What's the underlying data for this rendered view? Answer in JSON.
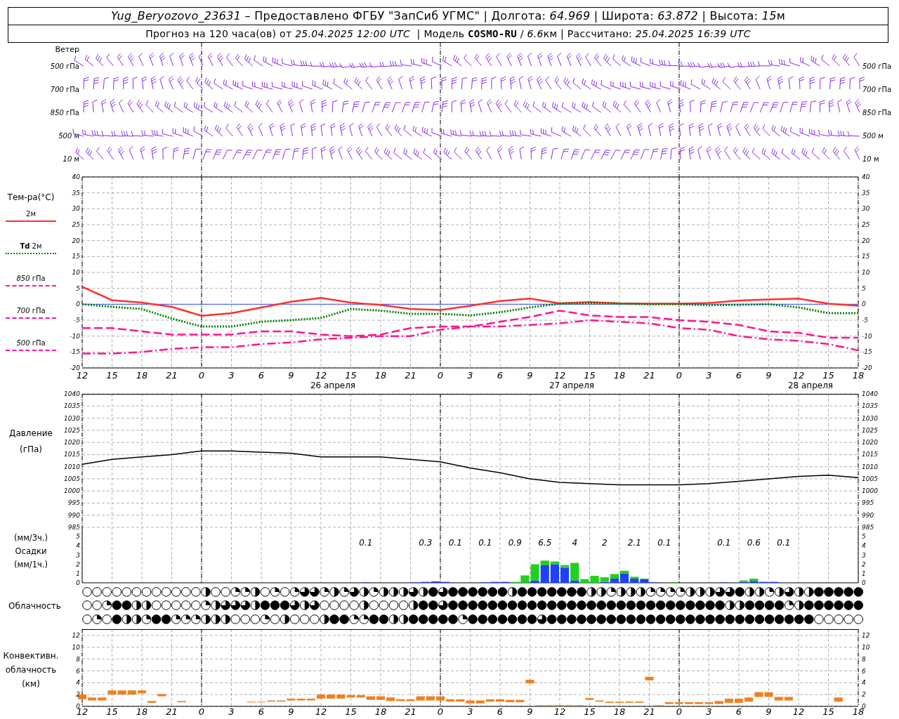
{
  "header": {
    "lines": [
      [
        {
          "text": "Yug_Beryozovo_23631",
          "kind": "italic"
        },
        {
          "text": " – Предоставлено ФГБУ \"ЗапСиб УГМС\" | Долгота: ",
          "kind": "plain"
        },
        {
          "text": "64.969",
          "kind": "italic"
        },
        {
          "text": " | Широта: ",
          "kind": "plain"
        },
        {
          "text": "63.872",
          "kind": "italic"
        },
        {
          "text": " | Высота: ",
          "kind": "plain"
        },
        {
          "text": "15",
          "kind": "italic"
        },
        {
          "text": "м",
          "kind": "plain"
        }
      ],
      [
        {
          "text": "Прогноз на 120 часа(ов) от ",
          "kind": "plain"
        },
        {
          "text": "25.04.2025 12:00 UTC",
          "kind": "italic"
        },
        {
          "text": "  | Модель ",
          "kind": "plain"
        },
        {
          "text": "COSMO-RU",
          "kind": "bold"
        },
        {
          "text": " / ",
          "kind": "plain"
        },
        {
          "text": "6.6",
          "kind": "italic"
        },
        {
          "text": "км | Рассчитано: ",
          "kind": "plain"
        },
        {
          "text": "25.04.2025 16:39 UTC",
          "kind": "italic"
        }
      ]
    ]
  },
  "wind": {
    "label": "Ветер",
    "levels": [
      "*500* гПа",
      "*700* гПа",
      "*850* гПа",
      "*500* м",
      "*10* м"
    ],
    "right_levels": [
      "*500* гПа",
      "*700* гПа",
      "*850* гПа",
      "*500* м",
      "*10* м"
    ]
  },
  "temperature": {
    "label": "Тем-ра(°C)",
    "legend": [
      {
        "label": "2м",
        "color": "#ff3030",
        "kind": "solid"
      },
      {
        "label": "**Td** 2м",
        "color": "#008000",
        "kind": "dotted"
      },
      {
        "label": "*850* гПа",
        "color": "#ff1493",
        "kind": "longdash"
      },
      {
        "label": "*700* гПа",
        "color": "#ff1493",
        "kind": "dashdot"
      },
      {
        "label": "*500* гПа",
        "color": "#ff1493",
        "kind": "dashed"
      }
    ],
    "chart_data": {
      "type": "line",
      "categories": [
        "12",
        "15",
        "18",
        "21",
        "0",
        "3",
        "6",
        "9",
        "12",
        "15",
        "18",
        "21",
        "0",
        "3",
        "6",
        "9",
        "12",
        "15",
        "18",
        "21",
        "0",
        "3",
        "6",
        "9",
        "12",
        "15",
        "18"
      ],
      "series": [
        {
          "color": "#3050ff",
          "line_style": "solid",
          "values": [
            0,
            0,
            0,
            0,
            0,
            0,
            0,
            0,
            0,
            0,
            0,
            0,
            0,
            0,
            0,
            0,
            0,
            0,
            0,
            0,
            0,
            0,
            0,
            0,
            0,
            0,
            0
          ]
        },
        {
          "color": "#ff3030",
          "line_style": "solid",
          "values": [
            5.5,
            1.3,
            0.5,
            -0.8,
            -3.6,
            -2.8,
            -1.0,
            0.8,
            2.0,
            0.5,
            -0.2,
            -1.5,
            -1.8,
            -0.5,
            1.0,
            1.8,
            0.3,
            0.7,
            0.3,
            0.2,
            0.2,
            0.4,
            1.2,
            1.5,
            1.8,
            0.2,
            -0.5
          ]
        },
        {
          "color": "#008000",
          "line_style": "dotted",
          "values": [
            0.0,
            -0.8,
            -1.5,
            -4.5,
            -7.0,
            -7.0,
            -5.5,
            -5.0,
            -4.3,
            -1.5,
            -2.0,
            -3.0,
            -3.0,
            -3.5,
            -2.5,
            -1.0,
            0.2,
            0.3,
            0.2,
            0.0,
            0.0,
            -0.3,
            -0.2,
            0.0,
            -1.0,
            -2.8,
            -2.8
          ]
        },
        {
          "color": "#ff1493",
          "line_style": "dashed",
          "values": [
            -7.5,
            -7.5,
            -8.5,
            -9.5,
            -9.5,
            -9.5,
            -8.5,
            -8.5,
            -9.5,
            -10.0,
            -9.5,
            -7.5,
            -7.0,
            -7.0,
            -5.5,
            -4.0,
            -2.0,
            -3.5,
            -4.0,
            -4.0,
            -5.0,
            -5.5,
            -6.5,
            -8.5,
            -9.0,
            -10.5,
            -10.5
          ]
        },
        {
          "color": "#ff1493",
          "line_style": "dashdot",
          "values": [
            -15.5,
            -15.5,
            -15.0,
            -14.0,
            -13.5,
            -13.5,
            -12.5,
            -12.0,
            -11.0,
            -10.5,
            -10.0,
            -10.0,
            -8.0,
            -7.0,
            -7.0,
            -6.5,
            -6.0,
            -5.0,
            -5.5,
            -6.0,
            -7.5,
            -8.0,
            -10.0,
            -11.0,
            -11.5,
            -12.5,
            -14.5
          ]
        }
      ],
      "ylim": [
        -20,
        40
      ],
      "yticks": [
        -20,
        -15,
        -10,
        -5,
        0,
        5,
        10,
        15,
        20,
        25,
        30,
        35,
        40
      ],
      "grid": true
    },
    "right_ticks": [
      "40",
      "35",
      "30",
      "25",
      "20",
      "15",
      "10",
      "5",
      "0",
      "-5",
      "-10",
      "-15",
      "-20"
    ],
    "day_labels": [
      "26 апреля",
      "27 апреля",
      "28 апреля"
    ]
  },
  "pressure": {
    "labels": [
      "Давление",
      "(гПа)"
    ],
    "chart_data": {
      "type": "line",
      "grid": true,
      "series": [
        {
          "color": "#000000",
          "values": [
            1011,
            1013,
            1014,
            1015,
            1016.5,
            1016.5,
            1016,
            1015.5,
            1014,
            1014,
            1014,
            1013,
            1012,
            1009.5,
            1007.5,
            1005,
            1003.5,
            1003,
            1002.5,
            1002.5,
            1002.5,
            1003,
            1004,
            1005,
            1006,
            1006.5,
            1005.5
          ]
        }
      ],
      "ylim": [
        985,
        1040
      ],
      "yticks": [
        985,
        990,
        995,
        1000,
        1005,
        1010,
        1015,
        1020,
        1025,
        1030,
        1035,
        1040
      ]
    },
    "right_ticks": [
      "1040",
      "1035",
      "1030",
      "1025",
      "1020",
      "1015",
      "1010",
      "1005",
      "1000",
      "995",
      "990",
      "985"
    ]
  },
  "precipitation": {
    "labels": [
      "(мм/3ч.)",
      "Осадки",
      "(мм/1ч.)"
    ],
    "chart_data": {
      "type": "bar",
      "stacked": true,
      "grid": true,
      "annotations": [
        "0.1",
        "0.3",
        "0.1",
        "0.1",
        "0.9",
        "6.5",
        "4",
        "2",
        "2.1",
        "0.1",
        "0.1",
        "0.6",
        "0.1"
      ],
      "series": [
        {
          "color": "#2040ff",
          "values": [
            0,
            0,
            0,
            0,
            0,
            0,
            0,
            0,
            0,
            0,
            0,
            0,
            0,
            0,
            0,
            0,
            0,
            0,
            0,
            0,
            0,
            0,
            0,
            0,
            0,
            0,
            0,
            0,
            0.05,
            0,
            0,
            0,
            0,
            0.05,
            0.1,
            0.15,
            0.1,
            0,
            0,
            0,
            0.05,
            0.1,
            0.1,
            0,
            0,
            0.25,
            1.9,
            2.0,
            1.6,
            0.25,
            0,
            0,
            0.1,
            0.45,
            1.0,
            0.45,
            0.4,
            0.05,
            0,
            0,
            0,
            0,
            0,
            0,
            0.05,
            0,
            0.1,
            0.2,
            0.1,
            0.1,
            0,
            0,
            0,
            0,
            0,
            0,
            0,
            0
          ]
        },
        {
          "color": "#20d020",
          "values": [
            0,
            0,
            0,
            0,
            0,
            0,
            0,
            0,
            0,
            0,
            0,
            0,
            0,
            0,
            0,
            0,
            0,
            0,
            0,
            0,
            0,
            0,
            0,
            0,
            0,
            0,
            0,
            0,
            0,
            0,
            0,
            0,
            0,
            0,
            0,
            0,
            0,
            0,
            0,
            0,
            0,
            0,
            0,
            0.1,
            0.8,
            1.75,
            0.5,
            0.3,
            0.3,
            1.9,
            0.4,
            0.75,
            0.5,
            0.5,
            0.3,
            0.2,
            0.05,
            0,
            0,
            0.05,
            0,
            0,
            0,
            0,
            0,
            0,
            0.15,
            0.25,
            0,
            0,
            0,
            0,
            0,
            0,
            0,
            0,
            0,
            0
          ]
        }
      ],
      "ylim": [
        0,
        6
      ],
      "yticks": [
        0,
        1,
        2,
        3,
        4,
        5
      ]
    },
    "right_ticks": [
      "5",
      "4",
      "3",
      "2",
      "1",
      "0"
    ]
  },
  "cloudiness": {
    "label": "Облачность",
    "rows": [
      {
        "cells": [
          {
            "kind": "clear"
          },
          {
            "kind": "clear"
          },
          {
            "kind": "clear"
          },
          {
            "kind": "clear"
          },
          {
            "kind": "clear"
          },
          {
            "kind": "clear"
          },
          {
            "kind": "clear"
          },
          {
            "kind": "clear"
          },
          {
            "kind": "clear"
          },
          {
            "kind": "clear"
          },
          {
            "kind": "clear"
          },
          {
            "kind": "clear"
          },
          {
            "kind": "half"
          },
          {
            "kind": "clear"
          },
          {
            "kind": "clear"
          },
          {
            "kind": "quarter"
          },
          {
            "kind": "quarter"
          },
          {
            "kind": "half"
          },
          {
            "kind": "clear"
          },
          {
            "kind": "quarter"
          },
          {
            "kind": "clear"
          },
          {
            "kind": "quarter"
          },
          {
            "kind": "threequarter"
          },
          {
            "kind": "threequarter"
          },
          {
            "kind": "quarter"
          },
          {
            "kind": "half"
          },
          {
            "kind": "quarter"
          },
          {
            "kind": "threequarter"
          },
          {
            "kind": "half"
          },
          {
            "kind": "quarter"
          },
          {
            "kind": "half"
          },
          {
            "kind": "half"
          },
          {
            "kind": "half"
          },
          {
            "kind": "threequarter"
          },
          {
            "kind": "half"
          },
          {
            "kind": "overcast"
          },
          {
            "kind": "threequarter"
          },
          {
            "kind": "overcast"
          },
          {
            "kind": "overcast"
          },
          {
            "kind": "overcast"
          },
          {
            "kind": "overcast"
          },
          {
            "kind": "overcast"
          },
          {
            "kind": "overcast"
          },
          {
            "kind": "half"
          },
          {
            "kind": "overcast"
          },
          {
            "kind": "overcast"
          },
          {
            "kind": "overcast"
          },
          {
            "kind": "overcast"
          },
          {
            "kind": "overcast"
          },
          {
            "kind": "overcast"
          },
          {
            "kind": "overcast"
          },
          {
            "kind": "half"
          },
          {
            "kind": "half"
          },
          {
            "kind": "quarter"
          },
          {
            "kind": "half"
          },
          {
            "kind": "half"
          },
          {
            "kind": "half"
          },
          {
            "kind": "quarter"
          },
          {
            "kind": "quarter"
          },
          {
            "kind": "quarter"
          },
          {
            "kind": "quarter"
          },
          {
            "kind": "half"
          },
          {
            "kind": "half"
          },
          {
            "kind": "half"
          },
          {
            "kind": "threequarter"
          },
          {
            "kind": "threequarter"
          },
          {
            "kind": "overcast"
          },
          {
            "kind": "half"
          },
          {
            "kind": "half"
          },
          {
            "kind": "quarter"
          },
          {
            "kind": "half"
          },
          {
            "kind": "threequarter"
          },
          {
            "kind": "half"
          },
          {
            "kind": "half"
          },
          {
            "kind": "overcast"
          },
          {
            "kind": "overcast"
          },
          {
            "kind": "overcast"
          },
          {
            "kind": "overcast"
          },
          {
            "kind": "overcast"
          }
        ]
      },
      {
        "cells": [
          {
            "kind": "clear"
          },
          {
            "kind": "clear"
          },
          {
            "kind": "quarter"
          },
          {
            "kind": "overcast"
          },
          {
            "kind": "overcast"
          },
          {
            "kind": "half"
          },
          {
            "kind": "half"
          },
          {
            "kind": "clear"
          },
          {
            "kind": "clear"
          },
          {
            "kind": "clear"
          },
          {
            "kind": "clear"
          },
          {
            "kind": "clear"
          },
          {
            "kind": "quarter"
          },
          {
            "kind": "half"
          },
          {
            "kind": "threequarter"
          },
          {
            "kind": "threequarter"
          },
          {
            "kind": "threequarter"
          },
          {
            "kind": "half"
          },
          {
            "kind": "overcast"
          },
          {
            "kind": "overcast"
          },
          {
            "kind": "overcast"
          },
          {
            "kind": "threequarter"
          },
          {
            "kind": "half"
          },
          {
            "kind": "threequarter"
          },
          {
            "kind": "clear"
          },
          {
            "kind": "clear"
          },
          {
            "kind": "clear"
          },
          {
            "kind": "clear"
          },
          {
            "kind": "half"
          },
          {
            "kind": "clear"
          },
          {
            "kind": "clear"
          },
          {
            "kind": "clear"
          },
          {
            "kind": "clear"
          },
          {
            "kind": "half"
          },
          {
            "kind": "overcast"
          },
          {
            "kind": "overcast"
          },
          {
            "kind": "threequarter"
          },
          {
            "kind": "overcast"
          },
          {
            "kind": "overcast"
          },
          {
            "kind": "overcast"
          },
          {
            "kind": "overcast"
          },
          {
            "kind": "overcast"
          },
          {
            "kind": "overcast"
          },
          {
            "kind": "overcast"
          },
          {
            "kind": "overcast"
          },
          {
            "kind": "overcast"
          },
          {
            "kind": "overcast"
          },
          {
            "kind": "overcast"
          },
          {
            "kind": "overcast"
          },
          {
            "kind": "overcast"
          },
          {
            "kind": "overcast"
          },
          {
            "kind": "overcast"
          },
          {
            "kind": "overcast"
          },
          {
            "kind": "overcast"
          },
          {
            "kind": "overcast"
          },
          {
            "kind": "overcast"
          },
          {
            "kind": "overcast"
          },
          {
            "kind": "overcast"
          },
          {
            "kind": "overcast"
          },
          {
            "kind": "overcast"
          },
          {
            "kind": "overcast"
          },
          {
            "kind": "overcast"
          },
          {
            "kind": "overcast"
          },
          {
            "kind": "overcast"
          },
          {
            "kind": "overcast"
          },
          {
            "kind": "half"
          },
          {
            "kind": "half"
          },
          {
            "kind": "overcast"
          },
          {
            "kind": "overcast"
          },
          {
            "kind": "overcast"
          },
          {
            "kind": "overcast"
          },
          {
            "kind": "quarter"
          },
          {
            "kind": "half"
          },
          {
            "kind": "overcast"
          },
          {
            "kind": "overcast"
          },
          {
            "kind": "overcast"
          },
          {
            "kind": "overcast"
          },
          {
            "kind": "overcast"
          },
          {
            "kind": "overcast"
          }
        ]
      },
      {
        "cells": [
          {
            "kind": "clear"
          },
          {
            "kind": "quarter"
          },
          {
            "kind": "clear"
          },
          {
            "kind": "overcast"
          },
          {
            "kind": "half"
          },
          {
            "kind": "half"
          },
          {
            "kind": "quarter"
          },
          {
            "kind": "overcast"
          },
          {
            "kind": "overcast"
          },
          {
            "kind": "quarter"
          },
          {
            "kind": "quarter"
          },
          {
            "kind": "quarter"
          },
          {
            "kind": "half"
          },
          {
            "kind": "half"
          },
          {
            "kind": "half"
          },
          {
            "kind": "clear"
          },
          {
            "kind": "clear"
          },
          {
            "kind": "clear"
          },
          {
            "kind": "quarter"
          },
          {
            "kind": "clear"
          },
          {
            "kind": "half"
          },
          {
            "kind": "clear"
          },
          {
            "kind": "clear"
          },
          {
            "kind": "clear"
          },
          {
            "kind": "half"
          },
          {
            "kind": "overcast"
          },
          {
            "kind": "overcast"
          },
          {
            "kind": "quarter"
          },
          {
            "kind": "quarter"
          },
          {
            "kind": "overcast"
          },
          {
            "kind": "overcast"
          },
          {
            "kind": "half"
          },
          {
            "kind": "half"
          },
          {
            "kind": "overcast"
          },
          {
            "kind": "overcast"
          },
          {
            "kind": "overcast"
          },
          {
            "kind": "overcast"
          },
          {
            "kind": "overcast"
          },
          {
            "kind": "quarter"
          },
          {
            "kind": "overcast"
          },
          {
            "kind": "overcast"
          },
          {
            "kind": "overcast"
          },
          {
            "kind": "overcast"
          },
          {
            "kind": "overcast"
          },
          {
            "kind": "overcast"
          },
          {
            "kind": "overcast"
          },
          {
            "kind": "threequarter"
          },
          {
            "kind": "overcast"
          },
          {
            "kind": "overcast"
          },
          {
            "kind": "overcast"
          },
          {
            "kind": "overcast"
          },
          {
            "kind": "overcast"
          },
          {
            "kind": "overcast"
          },
          {
            "kind": "overcast"
          },
          {
            "kind": "overcast"
          },
          {
            "kind": "overcast"
          },
          {
            "kind": "overcast"
          },
          {
            "kind": "overcast"
          },
          {
            "kind": "overcast"
          },
          {
            "kind": "overcast"
          },
          {
            "kind": "overcast"
          },
          {
            "kind": "overcast"
          },
          {
            "kind": "overcast"
          },
          {
            "kind": "overcast"
          },
          {
            "kind": "overcast"
          },
          {
            "kind": "overcast"
          },
          {
            "kind": "overcast"
          },
          {
            "kind": "overcast"
          },
          {
            "kind": "overcast"
          },
          {
            "kind": "overcast"
          },
          {
            "kind": "overcast"
          },
          {
            "kind": "overcast"
          },
          {
            "kind": "overcast"
          },
          {
            "kind": "overcast"
          },
          {
            "kind": "clear"
          },
          {
            "kind": "clear"
          },
          {
            "kind": "clear"
          },
          {
            "kind": "clear"
          },
          {
            "kind": "clear"
          }
        ]
      }
    ]
  },
  "convective": {
    "labels": [
      "Конвективн.",
      "облачность",
      "(км)"
    ],
    "chart_data": {
      "type": "candlestick",
      "categories": [
        "12",
        null,
        null,
        "15",
        null,
        null,
        "18",
        null,
        null,
        "21",
        null,
        null,
        "0",
        null,
        null,
        "3",
        null,
        null,
        "6",
        null,
        null,
        "9",
        null,
        null,
        "12",
        null,
        null,
        "15",
        null,
        null,
        "18",
        null,
        null,
        "21",
        null,
        null,
        "0",
        null,
        null,
        "3",
        null,
        null,
        "6",
        null,
        null,
        "9",
        null,
        null,
        "12",
        null,
        null,
        "15",
        null,
        null,
        "18",
        null,
        null,
        "21",
        null,
        null,
        "0",
        null,
        null,
        "3",
        null,
        null,
        "6",
        null,
        null,
        "9",
        null,
        null,
        "12",
        null,
        null,
        "15",
        null,
        null,
        "18"
      ],
      "series": [
        {
          "color": "#f08020",
          "ohlc": [
            [
              1.2,
              2.0,
              1.2,
              2.0
            ],
            [
              1.0,
              1.5,
              1.0,
              1.5
            ],
            [
              1.0,
              1.5,
              1.0,
              1.5
            ],
            [
              2.0,
              2.7,
              2.0,
              2.7
            ],
            [
              2.0,
              2.7,
              2.0,
              2.7
            ],
            [
              2.0,
              2.7,
              2.0,
              2.7
            ],
            [
              2.2,
              2.7,
              2.2,
              2.7
            ],
            [
              0.6,
              0.9,
              0.6,
              0.9
            ],
            [
              1.7,
              2.1,
              1.7,
              2.1
            ],
            null,
            [
              0.7,
              0.9,
              0.7,
              0.9
            ],
            null,
            null,
            null,
            null,
            null,
            null,
            [
              0.7,
              0.8,
              0.7,
              0.8
            ],
            [
              0.7,
              0.8,
              0.7,
              0.8
            ],
            [
              0.8,
              1.0,
              0.8,
              1.0
            ],
            [
              0.8,
              1.0,
              0.8,
              1.0
            ],
            [
              1.0,
              1.3,
              1.0,
              1.3
            ],
            [
              1.0,
              1.3,
              1.0,
              1.3
            ],
            [
              1.0,
              1.3,
              1.0,
              1.3
            ],
            [
              1.3,
              2.0,
              1.3,
              2.0
            ],
            [
              1.3,
              2.0,
              1.3,
              2.0
            ],
            [
              1.3,
              2.0,
              1.3,
              2.0
            ],
            [
              1.5,
              1.9,
              1.5,
              1.9
            ],
            [
              1.5,
              1.9,
              1.5,
              1.9
            ],
            [
              1.1,
              1.7,
              1.1,
              1.7
            ],
            [
              1.1,
              1.7,
              1.1,
              1.7
            ],
            [
              0.9,
              1.5,
              0.9,
              1.5
            ],
            [
              0.9,
              1.2,
              0.9,
              1.2
            ],
            [
              0.9,
              1.2,
              0.9,
              1.2
            ],
            [
              1.0,
              1.7,
              1.0,
              1.7
            ],
            [
              1.0,
              1.7,
              1.0,
              1.7
            ],
            [
              1.0,
              1.7,
              1.0,
              1.7
            ],
            [
              0.8,
              1.2,
              0.8,
              1.2
            ],
            [
              0.8,
              1.2,
              0.8,
              1.2
            ],
            [
              0.5,
              1.0,
              0.5,
              1.0
            ],
            [
              0.5,
              1.0,
              0.5,
              1.0
            ],
            [
              0.8,
              1.2,
              0.8,
              1.2
            ],
            [
              0.8,
              1.2,
              0.8,
              1.2
            ],
            [
              0.7,
              1.1,
              0.7,
              1.1
            ],
            [
              0.7,
              1.1,
              0.7,
              1.1
            ],
            [
              3.9,
              4.5,
              3.9,
              4.5
            ],
            [
              0.1,
              0.2,
              0.1,
              0.2
            ],
            [
              0.1,
              0.2,
              0.1,
              0.2
            ],
            [
              0.1,
              0.2,
              0.1,
              0.2
            ],
            [
              0.1,
              0.2,
              0.1,
              0.2
            ],
            [
              0.1,
              0.2,
              0.1,
              0.2
            ],
            [
              1.1,
              1.4,
              1.1,
              1.4
            ],
            [
              0.8,
              1.0,
              0.8,
              1.0
            ],
            [
              0.6,
              0.8,
              0.6,
              0.8
            ],
            [
              0.6,
              0.8,
              0.6,
              0.8
            ],
            [
              0.6,
              0.8,
              0.6,
              0.8
            ],
            [
              0.6,
              0.8,
              0.6,
              0.8
            ],
            [
              4.4,
              5.0,
              4.4,
              5.0
            ],
            [
              0.1,
              0.2,
              0.1,
              0.2
            ],
            [
              0.4,
              0.7,
              0.4,
              0.7
            ],
            [
              0.4,
              0.7,
              0.4,
              0.7
            ],
            [
              0.4,
              0.7,
              0.4,
              0.7
            ],
            [
              0.4,
              0.7,
              0.4,
              0.7
            ],
            [
              0.4,
              0.7,
              0.4,
              0.7
            ],
            [
              0.4,
              0.9,
              0.4,
              0.9
            ],
            [
              0.6,
              1.3,
              0.6,
              1.3
            ],
            [
              0.6,
              1.3,
              0.6,
              1.3
            ],
            [
              0.8,
              1.5,
              0.8,
              1.5
            ],
            [
              1.6,
              2.4,
              1.6,
              2.4
            ],
            [
              1.6,
              2.4,
              1.6,
              2.4
            ],
            [
              1.0,
              1.6,
              1.0,
              1.6
            ],
            [
              1.0,
              1.6,
              1.0,
              1.6
            ],
            null,
            null,
            null,
            null,
            [
              0.8,
              1.5,
              0.8,
              1.5
            ],
            null,
            null
          ]
        }
      ],
      "ylim": [
        0,
        12
      ],
      "yticks": [
        0,
        2,
        4,
        6,
        8,
        10,
        12
      ],
      "grid": true
    },
    "right_ticks": [
      "12",
      "10",
      "8",
      "6",
      "4",
      "2",
      "0"
    ]
  }
}
